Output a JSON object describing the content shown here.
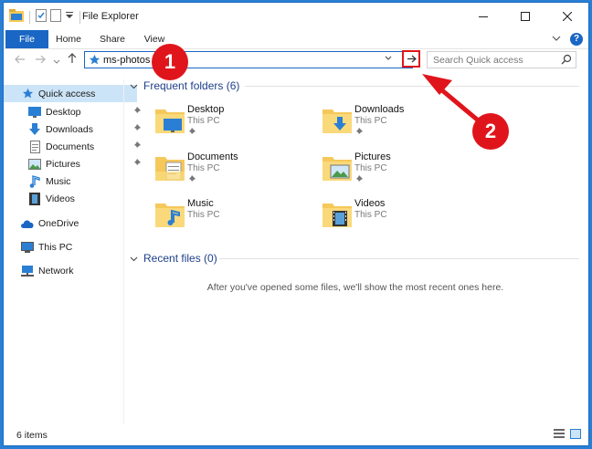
{
  "window": {
    "title": "File Explorer"
  },
  "ribbon": {
    "tabs": [
      "File",
      "Home",
      "Share",
      "View"
    ]
  },
  "address": {
    "value": "ms-photos"
  },
  "search": {
    "placeholder": "Search Quick access"
  },
  "sidebar": {
    "items": [
      {
        "label": "Quick access",
        "icon": "star-icon",
        "pinned": false,
        "selected": true
      },
      {
        "label": "Desktop",
        "icon": "desktop-icon",
        "pinned": true
      },
      {
        "label": "Downloads",
        "icon": "download-icon",
        "pinned": true
      },
      {
        "label": "Documents",
        "icon": "documents-icon",
        "pinned": true
      },
      {
        "label": "Pictures",
        "icon": "pictures-icon",
        "pinned": true
      },
      {
        "label": "Music",
        "icon": "music-icon",
        "pinned": false
      },
      {
        "label": "Videos",
        "icon": "videos-icon",
        "pinned": false
      },
      {
        "label": "OneDrive",
        "icon": "cloud-icon",
        "pinned": false
      },
      {
        "label": "This PC",
        "icon": "computer-icon",
        "pinned": false
      },
      {
        "label": "Network",
        "icon": "network-icon",
        "pinned": false
      }
    ]
  },
  "frequent": {
    "header": "Frequent folders (6)",
    "folders": [
      {
        "name": "Desktop",
        "location": "This PC",
        "pinned": true,
        "icon": "desktop-folder-icon"
      },
      {
        "name": "Downloads",
        "location": "This PC",
        "pinned": true,
        "icon": "downloads-folder-icon"
      },
      {
        "name": "Documents",
        "location": "This PC",
        "pinned": true,
        "icon": "documents-folder-icon"
      },
      {
        "name": "Pictures",
        "location": "This PC",
        "pinned": true,
        "icon": "pictures-folder-icon"
      },
      {
        "name": "Music",
        "location": "This PC",
        "pinned": false,
        "icon": "music-folder-icon"
      },
      {
        "name": "Videos",
        "location": "This PC",
        "pinned": false,
        "icon": "videos-folder-icon"
      }
    ]
  },
  "recent": {
    "header": "Recent files (0)",
    "empty_message": "After you've opened some files, we'll show the most recent ones here."
  },
  "status": {
    "text": "6 items"
  },
  "callouts": [
    "1",
    "2"
  ],
  "colors": {
    "accent": "#1a66c4",
    "callout": "#e0151c",
    "folder": "#f5c85a",
    "selection": "#cce4f7"
  }
}
